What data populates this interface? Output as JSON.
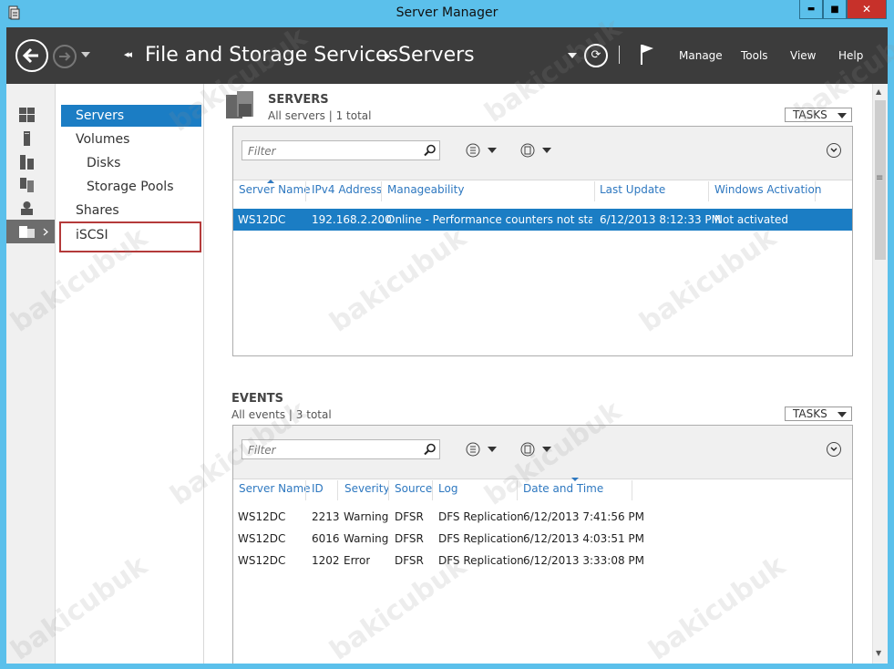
{
  "window": {
    "title": "Server Manager",
    "minimize": "▬",
    "maximize": "■",
    "close": "✕"
  },
  "header": {
    "breadcrumb": [
      "File and Storage Services",
      "Servers"
    ],
    "menu": [
      "Manage",
      "Tools",
      "View",
      "Help"
    ]
  },
  "left_icons": [
    "dashboard-icon",
    "local-server-icon",
    "all-servers-icon",
    "file-services-icon",
    "roles-icon",
    "storage-icon"
  ],
  "subnav": {
    "items": [
      {
        "label": "Servers",
        "selected": true
      },
      {
        "label": "Volumes"
      },
      {
        "label": "Disks"
      },
      {
        "label": "Storage Pools"
      },
      {
        "label": "Shares"
      },
      {
        "label": "iSCSI"
      }
    ]
  },
  "servers": {
    "title": "SERVERS",
    "subtitle": "All servers | 1 total",
    "tasks_label": "TASKS",
    "filter_placeholder": "Filter",
    "columns": [
      "Server Name",
      "IPv4 Address",
      "Manageability",
      "Last Update",
      "Windows Activation"
    ],
    "rows": [
      [
        "WS12DC",
        "192.168.2.200",
        "Online - Performance counters not started",
        "6/12/2013 8:12:33 PM",
        "Not activated"
      ]
    ]
  },
  "events": {
    "title": "EVENTS",
    "subtitle": "All events | 3 total",
    "tasks_label": "TASKS",
    "filter_placeholder": "Filter",
    "columns": [
      "Server Name",
      "ID",
      "Severity",
      "Source",
      "Log",
      "Date and Time"
    ],
    "rows": [
      [
        "WS12DC",
        "2213",
        "Warning",
        "DFSR",
        "DFS Replication",
        "6/12/2013 7:41:56 PM"
      ],
      [
        "WS12DC",
        "6016",
        "Warning",
        "DFSR",
        "DFS Replication",
        "6/12/2013 4:03:51 PM"
      ],
      [
        "WS12DC",
        "1202",
        "Error",
        "DFSR",
        "DFS Replication",
        "6/12/2013 3:33:08 PM"
      ]
    ]
  },
  "watermark": "bakicubuk",
  "colors": {
    "accent": "#1b7dc4",
    "header": "#3c3c3c",
    "title_bar": "#5bc0eb",
    "highlight_box": "#b43a3a"
  }
}
